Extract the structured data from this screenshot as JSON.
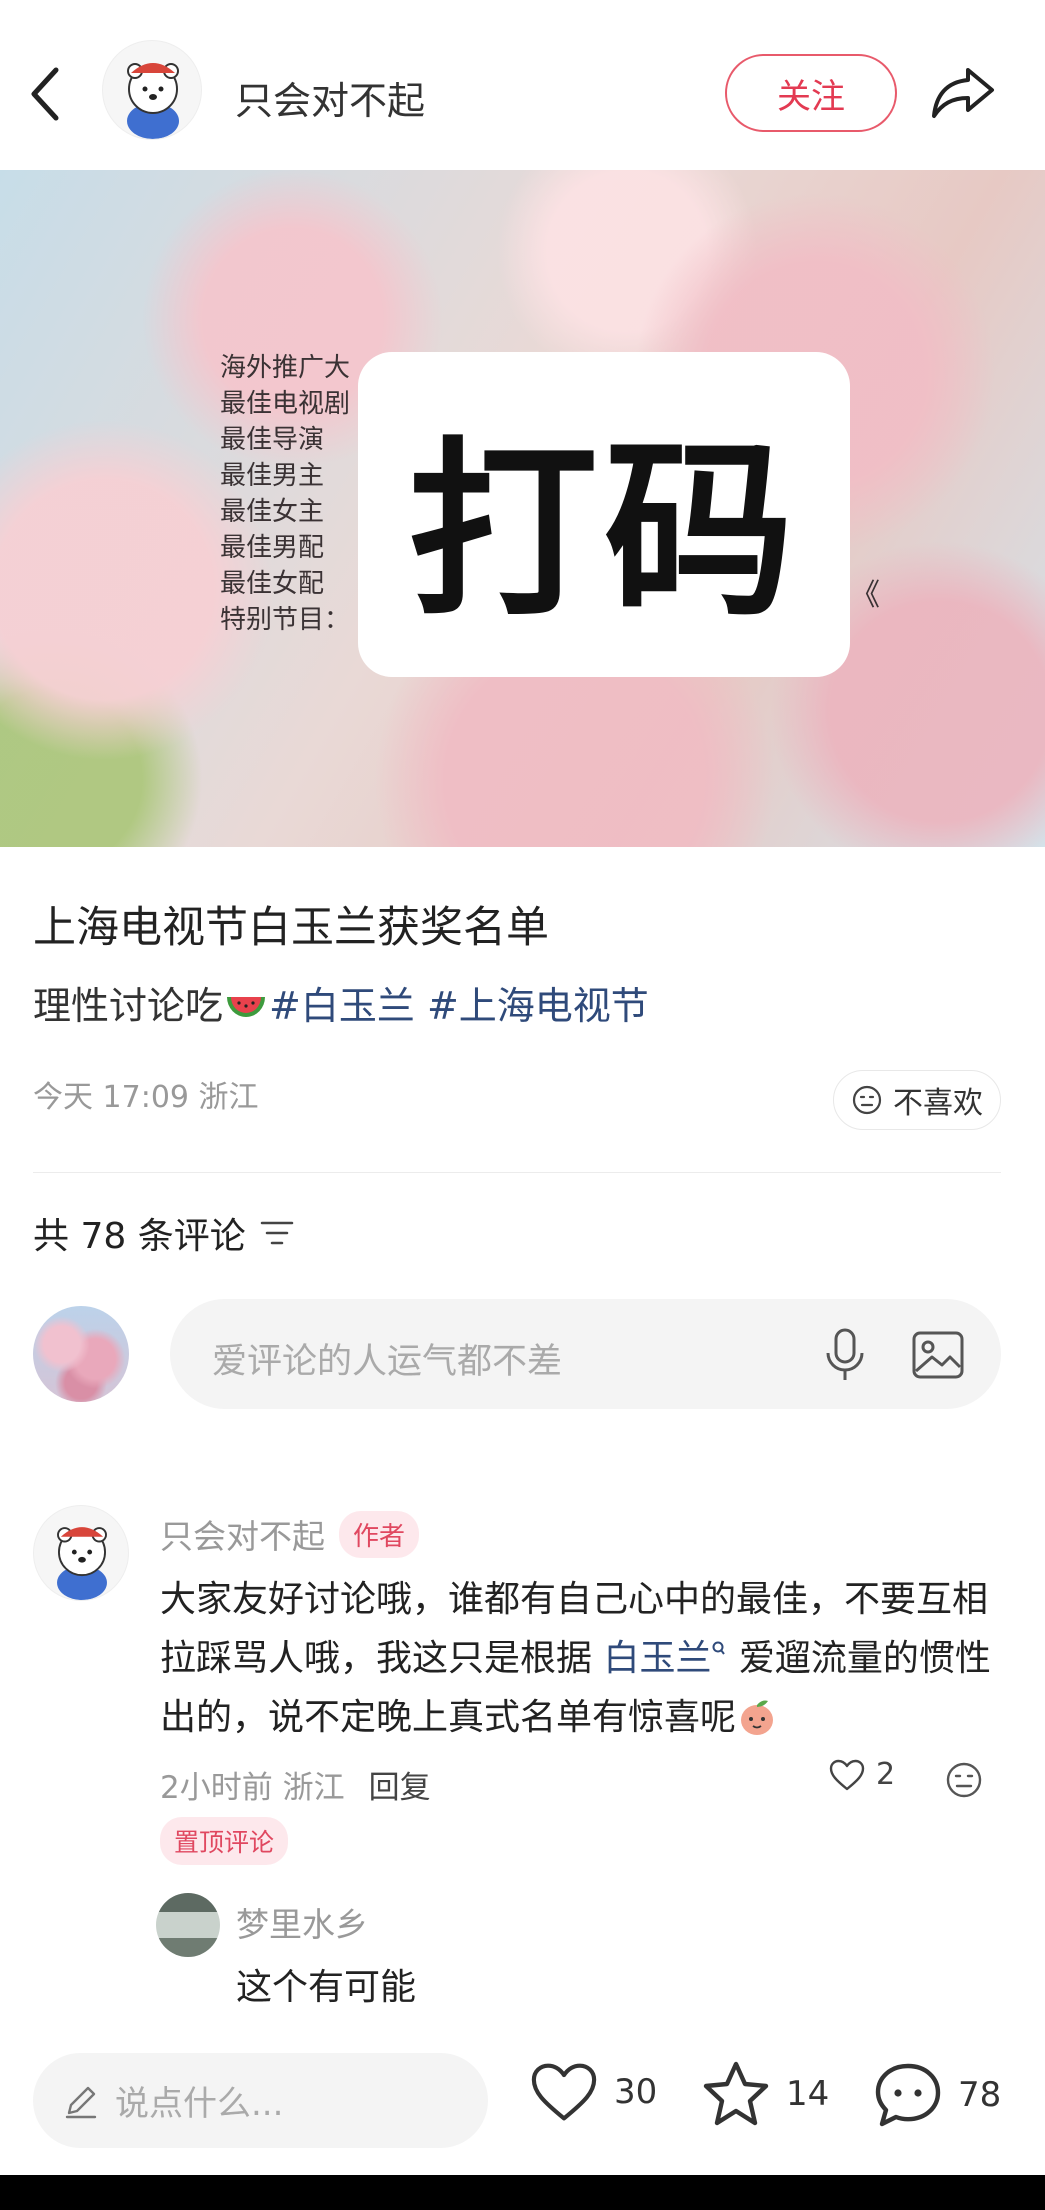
{
  "header": {
    "author_name": "只会对不起",
    "follow_label": "关注"
  },
  "hero": {
    "lines": [
      "海外推广大",
      "最佳电视剧",
      "最佳导演",
      "最佳男主",
      "最佳女主",
      "最佳男配",
      "最佳女配",
      "特别节目："
    ],
    "mask_text": "打码",
    "right_mark": "《"
  },
  "post": {
    "title": "上海电视节白玉兰获奖名单",
    "desc_text": "理性讨论吃",
    "tags": [
      "#白玉兰",
      "#上海电视节"
    ],
    "meta": "今天 17:09 浙江",
    "dislike_label": "不喜欢"
  },
  "comments": {
    "count_label": "共 78 条评论",
    "input_placeholder": "爱评论的人运气都不差",
    "items": [
      {
        "name": "只会对不起",
        "badge": "作者",
        "text_part1": "大家友好讨论哦，谁都有自己心中的最佳，不要互相拉踩骂人哦，我这只是根据 ",
        "link": "白玉兰",
        "text_part2": " 爱遛流量的惯性出的，说不定晚上真式名单有惊喜呢",
        "time_loc": "2小时前 浙江",
        "reply_label": "回复",
        "likes": "2",
        "pinned_label": "置顶评论",
        "reply": {
          "name": "梦里水乡",
          "text": "这个有可能"
        }
      }
    ]
  },
  "bottom_bar": {
    "input_placeholder": "说点什么...",
    "likes": "30",
    "stars": "14",
    "comments": "78"
  }
}
